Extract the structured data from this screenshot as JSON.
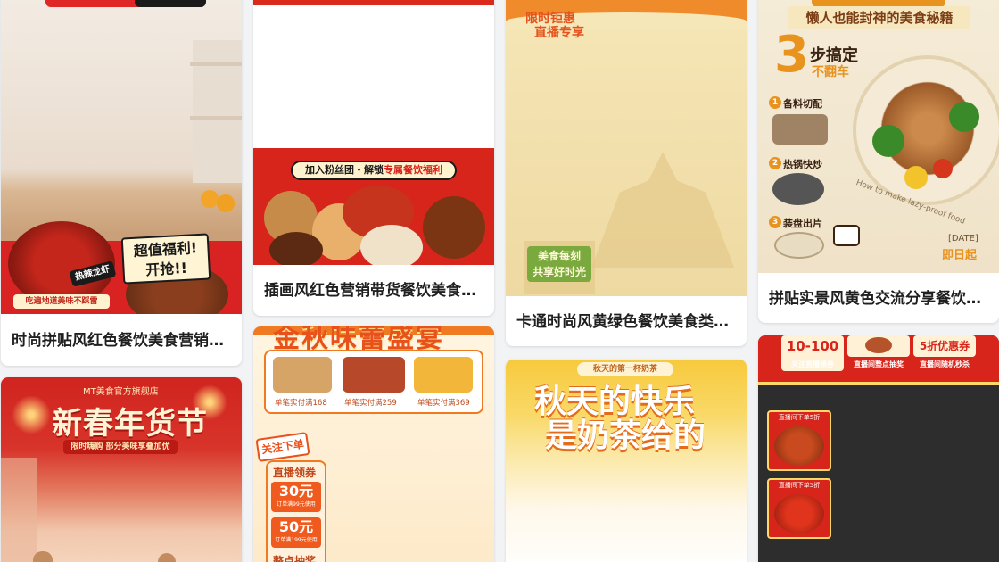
{
  "cards": [
    {
      "title": "时尚拼贴风红色餐饮美食营销…",
      "badge_main": "超值福利!",
      "badge_sub": "开抢!!",
      "tag": "热辣龙虾",
      "strip": "吃遍地道美味不踩雷"
    },
    {
      "title": "插画风红色营销带货餐饮美食…",
      "banner": "加入粉丝团・解锁",
      "banner_hl": "专属餐饮福利"
    },
    {
      "title": "卡通时尚风黄绿色餐饮美食类…",
      "top_text_1": "限时钜惠",
      "top_text_2": "直播专享",
      "sign_1": "美食每刻",
      "sign_2": "共享好时光"
    },
    {
      "title": "拼贴实景风黄色交流分享餐饮…",
      "headline": "懒人也能封神的美食秘籍",
      "big_number": "3",
      "sub_1": "步搞定",
      "sub_2": "不翻车",
      "steps": [
        {
          "num": "1",
          "label": "备料切配"
        },
        {
          "num": "2",
          "label": "热锅快炒"
        },
        {
          "num": "3",
          "label": "装盘出片"
        }
      ],
      "curve_text": "How to make lazy-proof food",
      "date_label": "[DATE]",
      "date_sub": "即日起"
    },
    {
      "shop": "MT美食官方旗舰店",
      "headline": "新春年货节",
      "sub": "限时嗨购 部分美味享叠加优"
    },
    {
      "headline": "金秋味蕾盛宴",
      "deals": [
        "单笔实付满168",
        "单笔实付满259",
        "单笔实付满369"
      ],
      "follow": "关注下单",
      "live": "直播领券",
      "coupons": [
        {
          "value": "30元",
          "note": "订单满99元使用"
        },
        {
          "value": "50元",
          "note": "订单满199元使用"
        }
      ],
      "bottom": "整点抽奖"
    },
    {
      "tag": "秋天的第一杯奶茶",
      "line_1": "秋天的快乐",
      "line_2": "是奶茶给的"
    },
    {
      "offers": [
        {
          "big": "10-100",
          "small": "关注直播领券"
        },
        {
          "big": "",
          "small": "直播间整点抽奖"
        },
        {
          "big": "5折优惠券",
          "small": "直播间随机秒杀"
        }
      ],
      "product_tags": [
        "直播间下单5折",
        "直播间下单5折"
      ]
    }
  ],
  "colors": {
    "brand_red": "#d81e1e",
    "accent_yellow": "#ffd84a",
    "orange": "#f07d1e",
    "title_text": "#1f1f1f"
  }
}
